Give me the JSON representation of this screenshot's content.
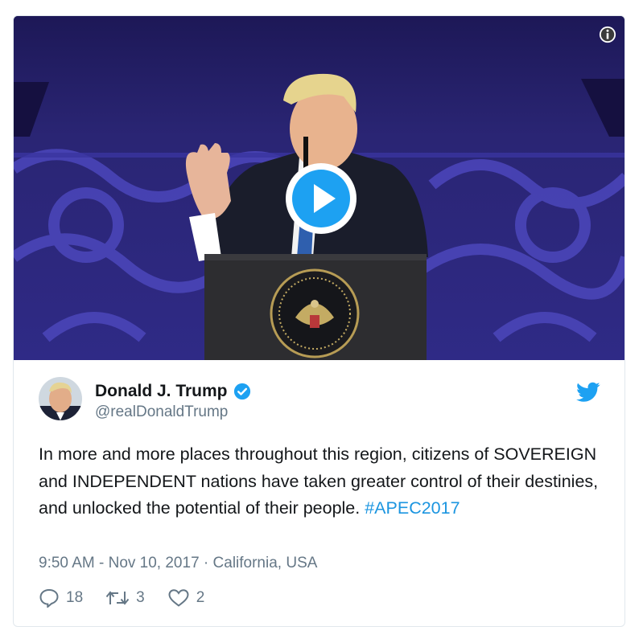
{
  "media": {
    "type": "video",
    "icons": {
      "info": "info-icon",
      "play": "play-icon"
    }
  },
  "author": {
    "display_name": "Donald J. Trump",
    "handle": "@realDonaldTrump",
    "verified": true,
    "icons": {
      "verified": "verified-badge-icon",
      "brand": "twitter-bird-icon"
    }
  },
  "tweet": {
    "text": "In more and more places throughout this region, citizens of SOVEREIGN and INDEPENDENT nations have taken greater control of their destinies, and unlocked the potential of their people. ",
    "hashtag": "#APEC2017"
  },
  "meta": {
    "time": "9:50 AM",
    "separator": " - ",
    "date": "Nov 10, 2017",
    "dot": " · ",
    "location": "California, USA"
  },
  "actions": {
    "replies": "18",
    "retweets": "3",
    "likes": "2"
  },
  "colors": {
    "brand": "#1da1f2",
    "link": "#1b95e0",
    "muted": "#657786",
    "text": "#14171a",
    "video_bg": "#241f63"
  }
}
